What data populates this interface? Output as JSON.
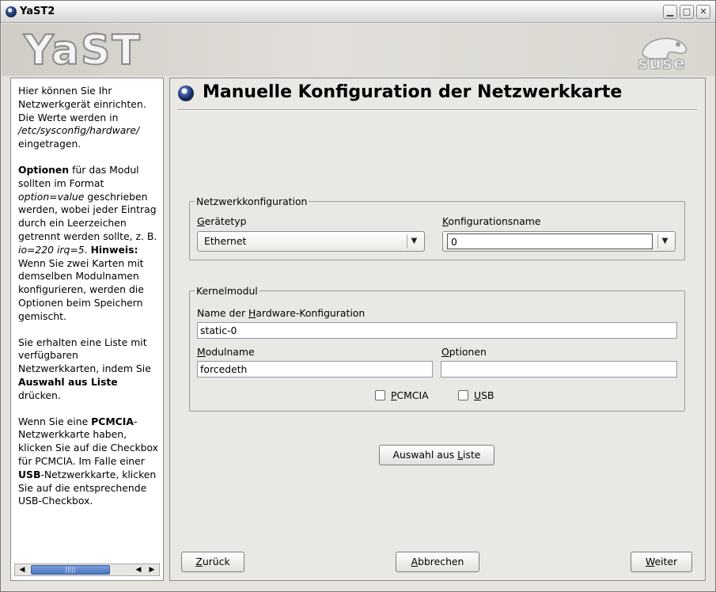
{
  "window": {
    "title": "YaST2"
  },
  "banner": {
    "logo": "YaST",
    "brand": "suse"
  },
  "help": {
    "p1": {
      "a": "Hier können Sie Ihr Netzwerkgerät einrichten. Die Werte werden in ",
      "path": "/etc/sysconfig/hardware/",
      "b": " eingetragen."
    },
    "p2": {
      "bold1": "Optionen",
      "a": " für das Modul sollten im Format ",
      "it1": "option=value",
      "b": " geschrieben werden, wobei jeder Eintrag durch ein Leerzeichen getrennt werden sollte, z. B. ",
      "it2": "io=220 irq=5",
      "c": ". ",
      "bold2": "Hinweis:",
      "d": " Wenn Sie zwei Karten mit demselben Modulnamen konfigurieren, werden die Optionen beim Speichern gemischt."
    },
    "p3": {
      "a": "Sie erhalten eine Liste mit verfügbaren Netzwerkkarten, indem Sie ",
      "bold": "Auswahl aus Liste",
      "b": " drücken."
    },
    "p4": {
      "a": "Wenn Sie eine ",
      "bold1": "PCMCIA",
      "b": "-Netzwerkkarte haben, klicken Sie auf die Checkbox für PCMCIA. Im Falle einer ",
      "bold2": "USB",
      "c": "-Netzwerkkarte, klicken Sie auf die entsprechende USB-Checkbox."
    }
  },
  "main": {
    "heading": "Manuelle Konfiguration der Netzwerkkarte",
    "netconf": {
      "legend": "Netzwerkkonfiguration",
      "devtype": {
        "label_u": "G",
        "label_rest": "erätetyp",
        "value": "Ethernet"
      },
      "confname": {
        "label_u": "K",
        "label_rest": "onfigurationsname",
        "value": "0"
      }
    },
    "kernel": {
      "legend": "Kernelmodul",
      "hwconf": {
        "label_pre": "Name der ",
        "label_u": "H",
        "label_rest": "ardware-Konfiguration",
        "value": "static-0"
      },
      "modname": {
        "label_u": "M",
        "label_rest": "odulname",
        "value": "forcedeth"
      },
      "options": {
        "label_u": "O",
        "label_rest": "ptionen",
        "value": ""
      },
      "pcmcia": {
        "label_u": "P",
        "label_rest": "CMCIA",
        "checked": false
      },
      "usb": {
        "label_u": "U",
        "label_rest": "SB",
        "checked": false
      }
    },
    "select_btn": {
      "pre": "Auswahl aus ",
      "u": "L",
      "rest": "iste"
    }
  },
  "footer": {
    "back": {
      "u": "Z",
      "rest": "urück"
    },
    "abort": {
      "u": "A",
      "rest": "bbrechen"
    },
    "next": {
      "u": "W",
      "rest": "eiter"
    }
  }
}
